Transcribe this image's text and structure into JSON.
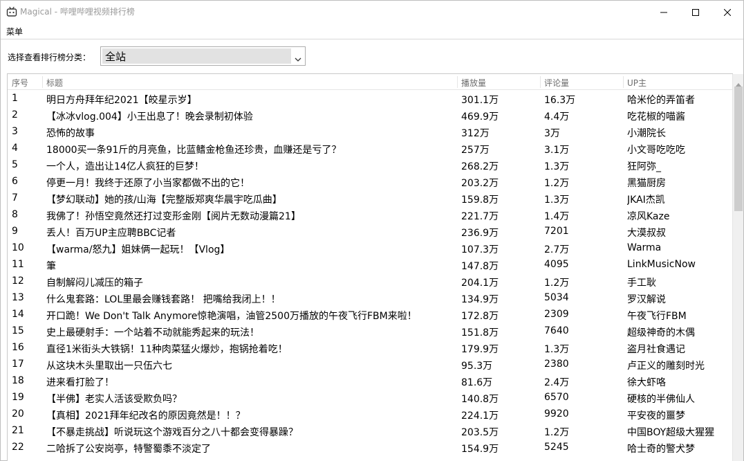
{
  "window": {
    "app_name": "Magical",
    "separator": " - ",
    "title": "哔哩哔哩视频排行榜"
  },
  "menu": {
    "label": "菜单"
  },
  "category": {
    "label": "选择查看排行榜分类：",
    "selected": "全站"
  },
  "table": {
    "headers": {
      "rank": "序号",
      "title": "标题",
      "plays": "播放量",
      "comments": "评论量",
      "up": "UP主"
    },
    "rows": [
      {
        "rank": "1",
        "title": "明日方舟拜年纪2021【皎星示岁】",
        "plays": "301.1万",
        "comments": "16.3万",
        "up": "哈米伦的弄笛者"
      },
      {
        "rank": "2",
        "title": "【冰冰vlog.004】小王出息了！晚会录制初体验",
        "plays": "469.9万",
        "comments": "4.4万",
        "up": "吃花椒的喵酱"
      },
      {
        "rank": "3",
        "title": "恐怖的故事",
        "plays": "312万",
        "comments": "3万",
        "up": "小潮院长"
      },
      {
        "rank": "4",
        "title": "18000买一条91斤的月亮鱼，比蓝鳍金枪鱼还珍贵，血赚还是亏了？",
        "plays": "257万",
        "comments": "3.1万",
        "up": "小文哥吃吃吃"
      },
      {
        "rank": "5",
        "title": "一个人，造出让14亿人疯狂的巨梦！",
        "plays": "268.2万",
        "comments": "1.3万",
        "up": "狂阿弥_"
      },
      {
        "rank": "6",
        "title": "停更一月！我终于还原了小当家都做不出的它！",
        "plays": "203.2万",
        "comments": "1.2万",
        "up": "黑猫厨房"
      },
      {
        "rank": "7",
        "title": "【梦幻联动】她的孩/山海【完整版郑爽华晨宇吃瓜曲】",
        "plays": "159.8万",
        "comments": "1.3万",
        "up": "JKAI杰凯"
      },
      {
        "rank": "8",
        "title": "我佛了！孙悟空竟然还打过变形金刚【阅片无数动漫篇21】",
        "plays": "221.7万",
        "comments": "1.4万",
        "up": "凉风Kaze"
      },
      {
        "rank": "9",
        "title": "丢人！百万UP主应聘BBC记者",
        "plays": "236.9万",
        "comments": "7201",
        "up": "大漠叔叔"
      },
      {
        "rank": "10",
        "title": "【warma/怒九】姐妹俩一起玩！【Vlog】",
        "plays": "107.3万",
        "comments": "2.7万",
        "up": "Warma"
      },
      {
        "rank": "11",
        "title": "筆",
        "plays": "147.8万",
        "comments": "4095",
        "up": "LinkMusicNow"
      },
      {
        "rank": "12",
        "title": "自制解闷儿减压的箱子",
        "plays": "204.1万",
        "comments": "1.2万",
        "up": "手工耿"
      },
      {
        "rank": "13",
        "title": "什么鬼套路：LOL里最会赚钱套路！ 把嘴给我闭上！！",
        "plays": "134.9万",
        "comments": "5034",
        "up": "罗汉解说"
      },
      {
        "rank": "14",
        "title": "开口跪！We Don't Talk Anymore惊艳演唱，油管2500万播放的午夜飞行FBM来啦！",
        "plays": "172.8万",
        "comments": "2309",
        "up": "午夜飞行FBM"
      },
      {
        "rank": "15",
        "title": "史上最硬射手：一个站着不动就能秀起来的玩法！",
        "plays": "151.8万",
        "comments": "7640",
        "up": "超级神奇的木偶"
      },
      {
        "rank": "16",
        "title": "直径1米街头大铁锅！11种肉菜猛火爆炒，抱锅抢着吃！",
        "plays": "179.9万",
        "comments": "1.3万",
        "up": "盗月社食遇记"
      },
      {
        "rank": "17",
        "title": "从这块木头里取出一只伍六七",
        "plays": "95.3万",
        "comments": "2380",
        "up": "卢正义的雕刻时光"
      },
      {
        "rank": "18",
        "title": "进来看打脸了！",
        "plays": "81.6万",
        "comments": "2.4万",
        "up": "徐大虾咯"
      },
      {
        "rank": "19",
        "title": "【半佛】老实人活该受欺负吗？",
        "plays": "140.8万",
        "comments": "6570",
        "up": "硬核的半佛仙人"
      },
      {
        "rank": "20",
        "title": "【真相】2021拜年纪改名的原因竟然是！！？",
        "plays": "224.1万",
        "comments": "9920",
        "up": "平安夜的噩梦"
      },
      {
        "rank": "21",
        "title": "【不暴走挑战】听说玩这个游戏百分之八十都会变得暴躁？",
        "plays": "203.5万",
        "comments": "1.2万",
        "up": "中国BOY超级大猩猩"
      },
      {
        "rank": "22",
        "title": "二哈拆了公安岗亭，特警蜀黍不淡定了",
        "plays": "154.9万",
        "comments": "5245",
        "up": "哈士奇的警犬梦"
      }
    ]
  },
  "colors": {
    "title_text": "#9a9a9a",
    "header_text": "#6d6d6d",
    "select_bg": "#e2e2e2",
    "scroll_thumb": "#cdcdcd"
  },
  "icons": {
    "app": "tv-icon",
    "minimize": "minimize-icon",
    "maximize": "maximize-icon",
    "close": "close-icon",
    "dropdown": "chevron-down-icon",
    "scroll_up": "scroll-up-arrow-icon"
  }
}
